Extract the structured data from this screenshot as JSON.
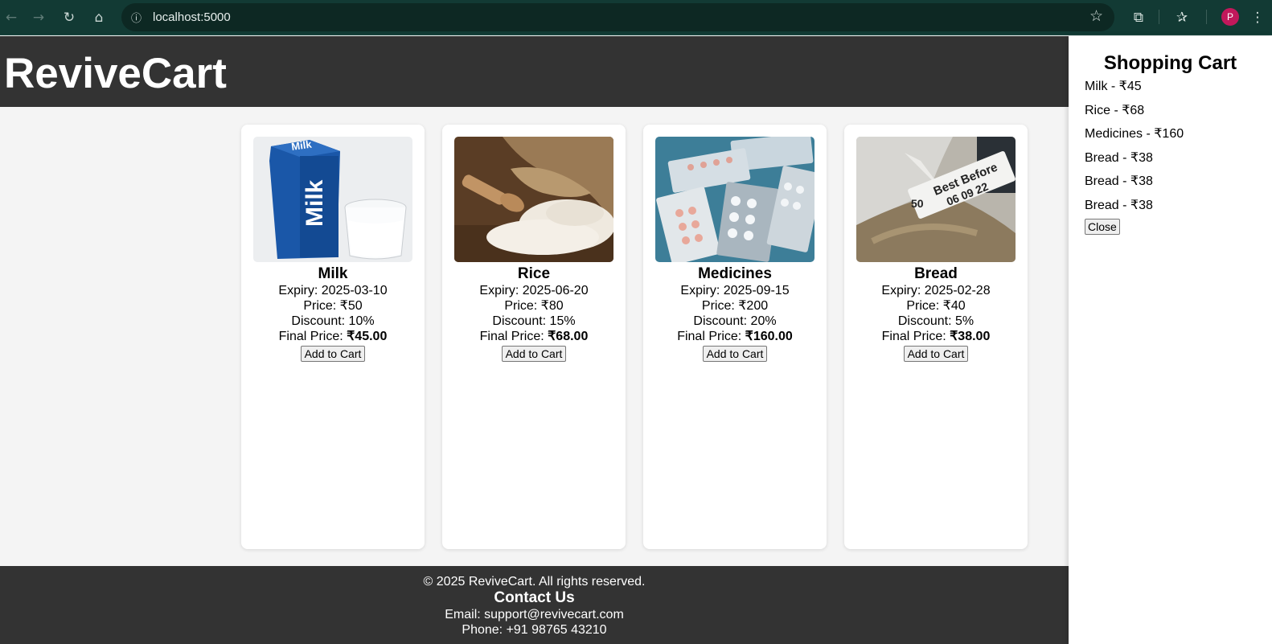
{
  "browser": {
    "url": "localhost:5000",
    "profile_initial": "P"
  },
  "header": {
    "brand": "ReviveCart"
  },
  "products": [
    {
      "name": "Milk",
      "expiry": "Expiry: 2025-03-10",
      "price": "Price: ₹50",
      "discount": "Discount: 10%",
      "final_label": "Final Price: ",
      "final_value": "₹45.00",
      "button": "Add to Cart"
    },
    {
      "name": "Rice",
      "expiry": "Expiry: 2025-06-20",
      "price": "Price: ₹80",
      "discount": "Discount: 15%",
      "final_label": "Final Price: ",
      "final_value": "₹68.00",
      "button": "Add to Cart"
    },
    {
      "name": "Medicines",
      "expiry": "Expiry: 2025-09-15",
      "price": "Price: ₹200",
      "discount": "Discount: 20%",
      "final_label": "Final Price: ",
      "final_value": "₹160.00",
      "button": "Add to Cart"
    },
    {
      "name": "Bread",
      "expiry": "Expiry: 2025-02-28",
      "price": "Price: ₹40",
      "discount": "Discount: 5%",
      "final_label": "Final Price: ",
      "final_value": "₹38.00",
      "button": "Add to Cart"
    }
  ],
  "image_text": {
    "milk_carton": "Milk",
    "milk_carton_top": "Milk",
    "bread_tag_1": "Best Before",
    "bread_tag_2": "06 09 22",
    "bread_tag_3": "50"
  },
  "footer": {
    "copyright": "© 2025 ReviveCart. All rights reserved.",
    "contact_heading": "Contact Us",
    "email": "Email: support@revivecart.com",
    "phone": "Phone: +91 98765 43210"
  },
  "cart": {
    "title": "Shopping Cart",
    "items": [
      "Milk - ₹45",
      "Rice - ₹68",
      "Medicines - ₹160",
      "Bread - ₹38",
      "Bread - ₹38",
      "Bread - ₹38"
    ],
    "close_label": "Close"
  }
}
